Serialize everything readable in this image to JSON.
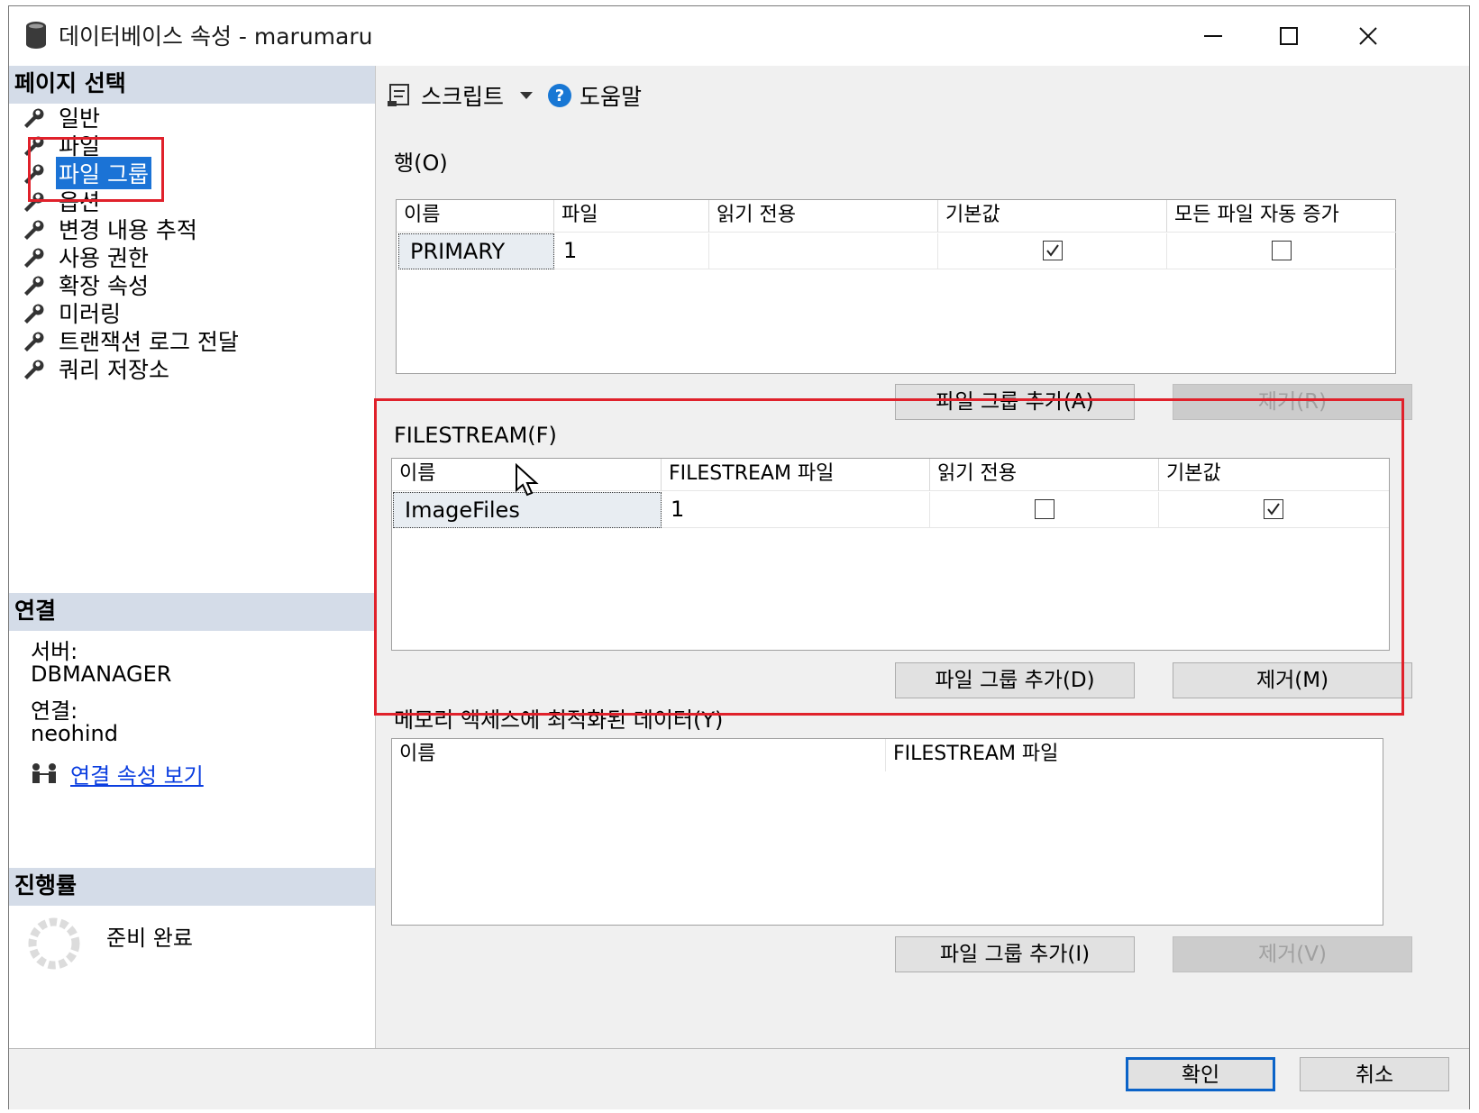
{
  "window": {
    "title": "데이터베이스 속성 - marumaru"
  },
  "window_controls": {
    "minimize": "—",
    "maximize": "☐",
    "close": "✕"
  },
  "left": {
    "page_select_header": "페이지 선택",
    "items": [
      "일반",
      "파일",
      "파일 그룹",
      "옵션",
      "변경 내용 추적",
      "사용 권한",
      "확장 속성",
      "미러링",
      "트랜잭션 로그 전달",
      "쿼리 저장소"
    ],
    "selected_index": 2,
    "connection_header": "연결",
    "server_label": "서버:",
    "server_value": "DBMANAGER",
    "connection_label": "연결:",
    "connection_value": "neohind",
    "view_conn_props": "연결 속성 보기",
    "progress_header": "진행률",
    "progress_status": "준비 완료"
  },
  "toolbar": {
    "script_label": "스크립트",
    "help_label": "도움말"
  },
  "rows_section": {
    "label": "행(O)",
    "columns": [
      "이름",
      "파일",
      "읽기 전용",
      "기본값",
      "모든 파일 자동 증가"
    ],
    "rows": [
      {
        "name": "PRIMARY",
        "files": "1",
        "read_only": null,
        "default": true,
        "autogrow_all": false
      }
    ],
    "add_button": "파일 그룹 추가(A)",
    "remove_button": "제거(R)"
  },
  "filestream_section": {
    "label": "FILESTREAM(F)",
    "columns": [
      "이름",
      "FILESTREAM 파일",
      "읽기 전용",
      "기본값"
    ],
    "rows": [
      {
        "name": "ImageFiles",
        "files": "1",
        "read_only": false,
        "default": true
      }
    ],
    "add_button": "파일 그룹 추가(D)",
    "remove_button": "제거(M)"
  },
  "memory_section": {
    "label": "메모리 액세스에 최적화된 데이터(Y)",
    "columns": [
      "이름",
      "FILESTREAM 파일"
    ],
    "add_button": "파일 그룹 추가(I)",
    "remove_button": "제거(V)"
  },
  "footer": {
    "ok_button": "확인",
    "cancel_button": "취소"
  },
  "colors": {
    "selection": "#1b73d6",
    "annotation_red": "#e0212b",
    "section_header": "#d4dce8"
  }
}
